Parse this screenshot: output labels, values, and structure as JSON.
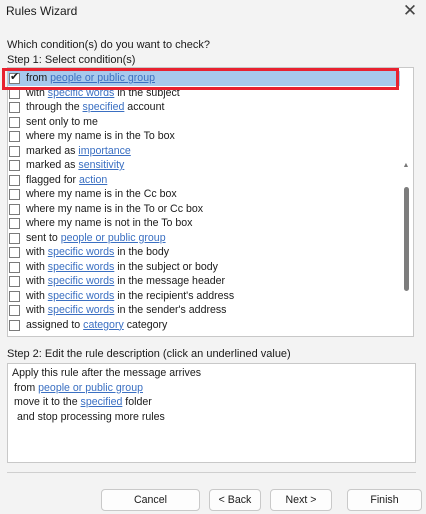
{
  "window": {
    "title": "Rules Wizard",
    "close_icon": "close-icon"
  },
  "prompt": "Which condition(s) do you want to check?",
  "step1_label": "Step 1: Select condition(s)",
  "conditions": [
    {
      "checked": true,
      "parts": [
        [
          "from ",
          false
        ],
        [
          "people or public group",
          true
        ]
      ]
    },
    {
      "checked": false,
      "parts": [
        [
          "with ",
          false
        ],
        [
          "specific words",
          true
        ],
        [
          " in the subject",
          false
        ]
      ]
    },
    {
      "checked": false,
      "parts": [
        [
          "through the ",
          false
        ],
        [
          "specified",
          true
        ],
        [
          " account",
          false
        ]
      ]
    },
    {
      "checked": false,
      "parts": [
        [
          "sent only to me",
          false
        ]
      ]
    },
    {
      "checked": false,
      "parts": [
        [
          "where my name is in the To box",
          false
        ]
      ]
    },
    {
      "checked": false,
      "parts": [
        [
          "marked as ",
          false
        ],
        [
          "importance",
          true
        ]
      ]
    },
    {
      "checked": false,
      "parts": [
        [
          "marked as ",
          false
        ],
        [
          "sensitivity",
          true
        ]
      ]
    },
    {
      "checked": false,
      "parts": [
        [
          "flagged for ",
          false
        ],
        [
          "action",
          true
        ]
      ]
    },
    {
      "checked": false,
      "parts": [
        [
          "where my name is in the Cc box",
          false
        ]
      ]
    },
    {
      "checked": false,
      "parts": [
        [
          "where my name is in the To or Cc box",
          false
        ]
      ]
    },
    {
      "checked": false,
      "parts": [
        [
          "where my name is not in the To box",
          false
        ]
      ]
    },
    {
      "checked": false,
      "parts": [
        [
          "sent to ",
          false
        ],
        [
          "people or public group",
          true
        ]
      ]
    },
    {
      "checked": false,
      "parts": [
        [
          "with ",
          false
        ],
        [
          "specific words",
          true
        ],
        [
          " in the body",
          false
        ]
      ]
    },
    {
      "checked": false,
      "parts": [
        [
          "with ",
          false
        ],
        [
          "specific words",
          true
        ],
        [
          " in the subject or body",
          false
        ]
      ]
    },
    {
      "checked": false,
      "parts": [
        [
          "with ",
          false
        ],
        [
          "specific words",
          true
        ],
        [
          " in the message header",
          false
        ]
      ]
    },
    {
      "checked": false,
      "parts": [
        [
          "with ",
          false
        ],
        [
          "specific words",
          true
        ],
        [
          " in the recipient's address",
          false
        ]
      ]
    },
    {
      "checked": false,
      "parts": [
        [
          "with ",
          false
        ],
        [
          "specific words",
          true
        ],
        [
          " in the sender's address",
          false
        ]
      ]
    },
    {
      "checked": false,
      "parts": [
        [
          "assigned to ",
          false
        ],
        [
          "category",
          true
        ],
        [
          " category",
          false
        ]
      ]
    }
  ],
  "step2_label": "Step 2: Edit the rule description (click an underlined value)",
  "description": [
    {
      "parts": [
        [
          "Apply this rule after the message arrives",
          false
        ]
      ]
    },
    {
      "parts": [
        [
          "from ",
          false
        ],
        [
          "people or public group",
          true
        ]
      ]
    },
    {
      "parts": [
        [
          "move it to the ",
          false
        ],
        [
          "specified",
          true
        ],
        [
          " folder",
          false
        ]
      ]
    },
    {
      "parts": [
        [
          "  and stop processing more rules",
          false
        ]
      ]
    }
  ],
  "buttons": {
    "cancel": "Cancel",
    "back": "< Back",
    "next": "Next >",
    "finish": "Finish"
  },
  "colors": {
    "highlight": "#e8212f",
    "link": "#3a6fc2",
    "selected_row": "#a7c9ec"
  }
}
